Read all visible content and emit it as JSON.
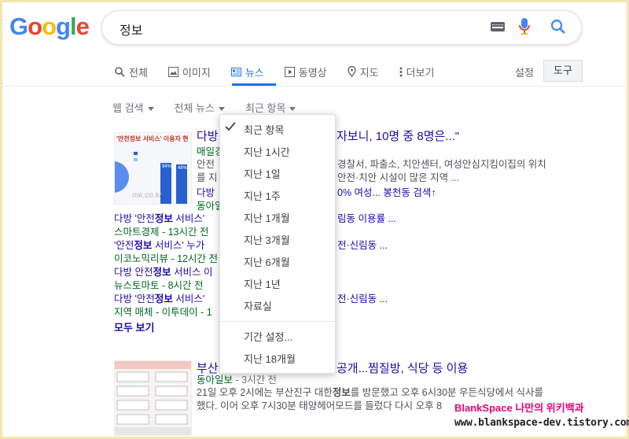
{
  "header": {
    "logo_letters": [
      {
        "ch": "G",
        "color": "#4285F4"
      },
      {
        "ch": "o",
        "color": "#EA4335"
      },
      {
        "ch": "o",
        "color": "#FBBC05"
      },
      {
        "ch": "g",
        "color": "#4285F4"
      },
      {
        "ch": "l",
        "color": "#34A853"
      },
      {
        "ch": "e",
        "color": "#EA4335"
      }
    ],
    "query": "정보",
    "icons": {
      "keyboard": "keyboard-icon",
      "mic": "mic-icon",
      "search": "search-icon"
    }
  },
  "tabs": [
    {
      "label": "전체",
      "icon": "search-icon",
      "active": false
    },
    {
      "label": "이미지",
      "icon": "image-icon",
      "active": false
    },
    {
      "label": "뉴스",
      "icon": "news-icon",
      "active": true
    },
    {
      "label": "동영상",
      "icon": "play-icon",
      "active": false
    },
    {
      "label": "지도",
      "icon": "map-pin-icon",
      "active": false
    },
    {
      "label": "더보기",
      "icon": "more-vert-icon",
      "active": false
    }
  ],
  "settings_label": "설정",
  "tools_label": "도구",
  "filters": [
    "웹 검색",
    "전체 뉴스",
    "최근 항목"
  ],
  "accent": "#1a73e8",
  "results": {
    "r1": {
      "title": "다방",
      "title_tail": "자보니, 10명 중 8명은...\"",
      "source": "매일경",
      "snip1_a": "안전",
      "snip1_b": "경찰서, 파출소, 치안센터, 여성안심지킴이집의 위치",
      "snip2_a": "를 지",
      "snip2_b": "안전·치안 시설이 많은 지역 ...",
      "rel1_a": "다방",
      "rel1_b": "0% 여성... 봉천동 검색↑",
      "rel1_src": "동아일",
      "thumb_caption": "'안전정보 서비스' 이용자 현",
      "thumb_wm": "mk.co.kr"
    },
    "sub": [
      {
        "a": "다방 '안전",
        "b": "정보",
        "c": " 서비스' ",
        "tail": "림동 이용률 ...",
        "src": "스마트경제 - 13시간 전"
      },
      {
        "a": "'안전",
        "b": "정보",
        "c": " 서비스' 누가 ",
        "tail": "전·신림동 ...",
        "src": "이코노믹리뷰 - 12시간 전"
      },
      {
        "a": "다방 안전",
        "b": "정보",
        "c": " 서비스 이",
        "tail": "",
        "src": "뉴스토마토 - 8시간 전"
      },
      {
        "a": "다방 '안전",
        "b": "정보",
        "c": " 서비스' ",
        "tail": "전·신림동 ...",
        "src": "지역 매체 - 이투데이 - 1"
      }
    ],
    "see_all": "모두 보기",
    "r2": {
      "title_a": "부산",
      "title_b": "공개...찜질방, 식당 등 이용",
      "source": "동아일보",
      "time": " - 3시간 전",
      "snip1_a": "21일 오후 2시에는 부산진구 대한",
      "snip1_b": "정보",
      "snip1_c": "를 방문했고 오후 6시30분 우든식당에서 식사를",
      "snip2_a": "했다. 이어 오후 7시30분 태양헤어모드를 들렀다 다시 오후 8"
    }
  },
  "menu": {
    "items": [
      "최근 항목",
      "지난 1시간",
      "지난 1일",
      "지난 1주",
      "지난 1개월",
      "지난 3개월",
      "지난 6개월",
      "지난 1년",
      "자료실"
    ],
    "items2": [
      "기간 설정...",
      "지난 18개월"
    ]
  },
  "watermark": {
    "line1": "BlankSpace 나만의 위키백과",
    "line2": "www.blankspace-dev.tistory.com"
  }
}
